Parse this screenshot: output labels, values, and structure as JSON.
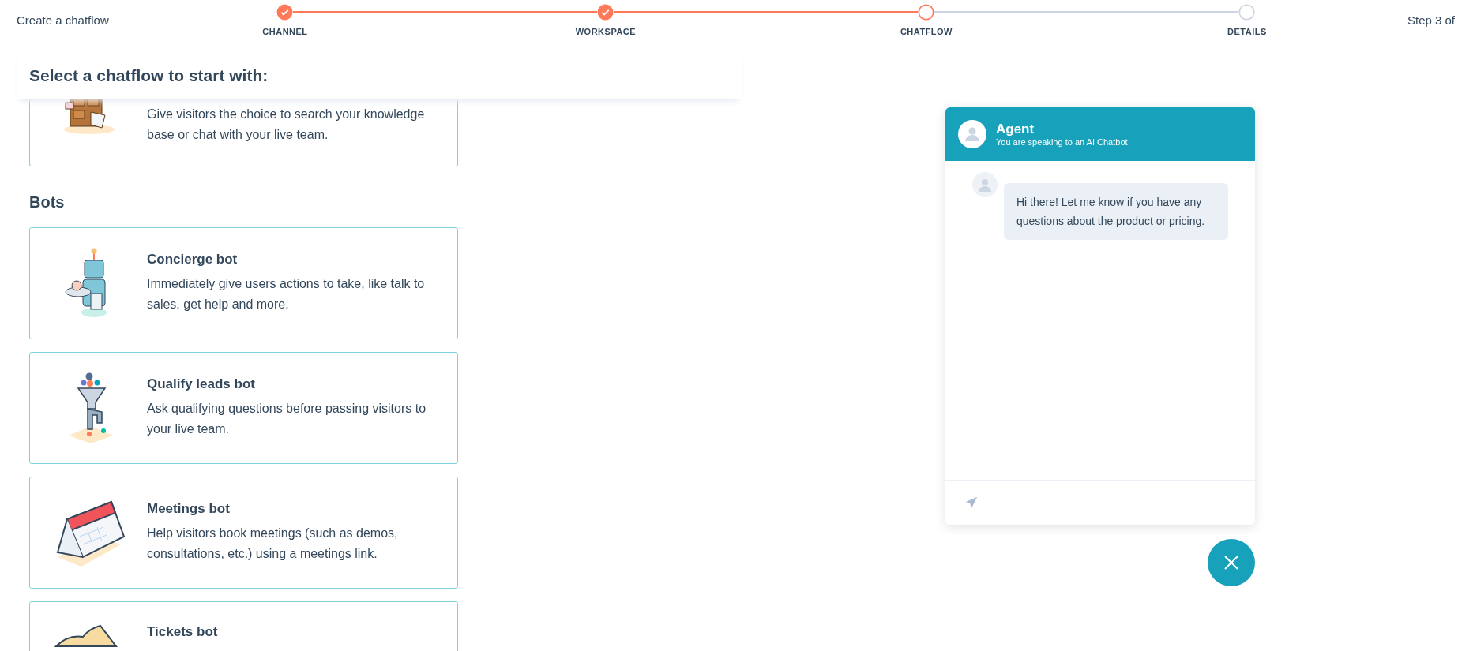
{
  "topbar": {
    "title": "Create a chatflow",
    "step_count": "Step 3 of"
  },
  "steps": [
    {
      "label": "CHANNEL",
      "completed": true,
      "current": false
    },
    {
      "label": "WORKSPACE",
      "completed": true,
      "current": false
    },
    {
      "label": "CHATFLOW",
      "completed": false,
      "current": true
    },
    {
      "label": "DETAILS",
      "completed": false,
      "current": false
    }
  ],
  "heading": "Select a chatflow to start with:",
  "partial_card": {
    "description": "Give visitors the choice to search your knowledge base or chat with your live team.",
    "kind": "cabinet"
  },
  "section_title": "Bots",
  "cards": [
    {
      "title": "Concierge bot",
      "description": "Immediately give users actions to take, like talk to sales, get help and more.",
      "kind": "robot"
    },
    {
      "title": "Qualify leads bot",
      "description": "Ask qualifying questions before passing visitors to your live team.",
      "kind": "funnel"
    },
    {
      "title": "Meetings bot",
      "description": "Help visitors book meetings (such as demos, consultations, etc.) using a meetings link.",
      "kind": "calendar"
    },
    {
      "title": "Tickets bot",
      "kind": "ticket"
    }
  ],
  "chat": {
    "agent_name": "Agent",
    "agent_subtitle": "You are speaking to an AI Chatbot",
    "messages": [
      {
        "text": "Hi there! Let me know if you have any questions about the product or pricing."
      }
    ]
  }
}
